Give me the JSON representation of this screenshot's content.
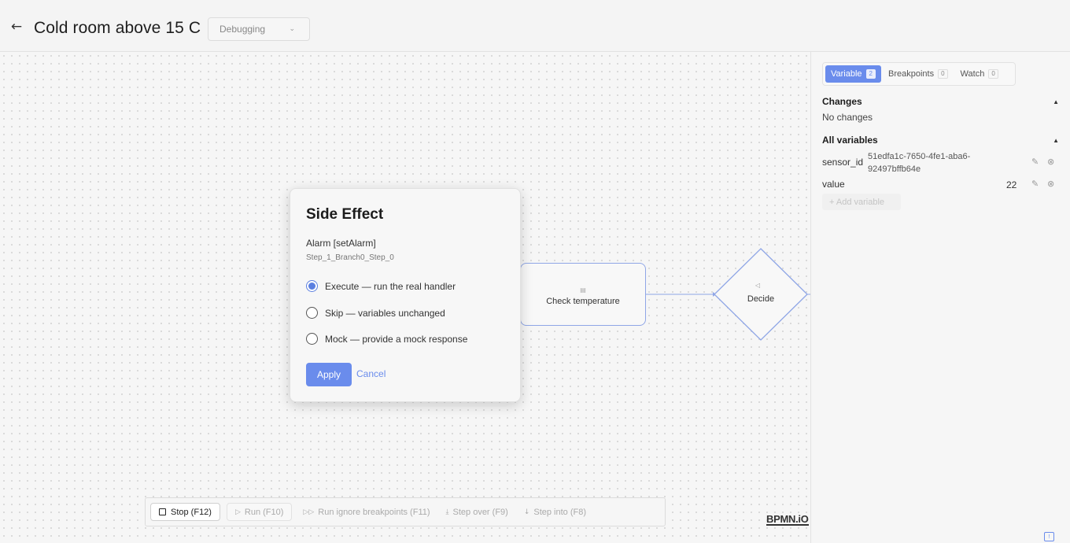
{
  "header": {
    "back_icon": "arrow-left-icon",
    "title": "Cold room above 15 C",
    "mode_select": {
      "value": "Debugging",
      "icon": "chevron-down-icon"
    }
  },
  "diagram": {
    "task": {
      "label": "Check temperature",
      "icon": "script-task-icon"
    },
    "gateway": {
      "label": "Decide",
      "icon": "gateway-icon"
    }
  },
  "modal": {
    "title": "Side Effect",
    "handler": "Alarm [setAlarm]",
    "step_id": "Step_1_Branch0_Step_0",
    "options": [
      {
        "label": "Execute — run the real handler",
        "checked": true
      },
      {
        "label": "Skip — variables unchanged",
        "checked": false
      },
      {
        "label": "Mock — provide a mock response",
        "checked": false
      }
    ],
    "apply_label": "Apply",
    "cancel_label": "Cancel"
  },
  "toolbar": {
    "stop": "Stop (F12)",
    "run": "Run (F10)",
    "run_ignore": "Run ignore breakpoints (F11)",
    "step_over": "Step over (F9)",
    "step_into": "Step into (F8)"
  },
  "logo": "BPMN.iO",
  "panel": {
    "tabs": [
      {
        "label": "Variable",
        "count": "2",
        "active": true
      },
      {
        "label": "Breakpoints",
        "count": "0",
        "active": false
      },
      {
        "label": "Watch",
        "count": "0",
        "active": false
      }
    ],
    "changes_title": "Changes",
    "changes_empty": "No changes",
    "all_vars_title": "All variables",
    "variables": [
      {
        "name": "sensor_id",
        "value_line1": "51edfa1c-7650-4fe1-aba6-",
        "value_line2": "92497bffb64e"
      },
      {
        "name": "value",
        "value": "22"
      }
    ],
    "add_variable": "+ Add variable"
  },
  "colors": {
    "accent": "#6a8cec",
    "border": "#8fa6e6"
  }
}
